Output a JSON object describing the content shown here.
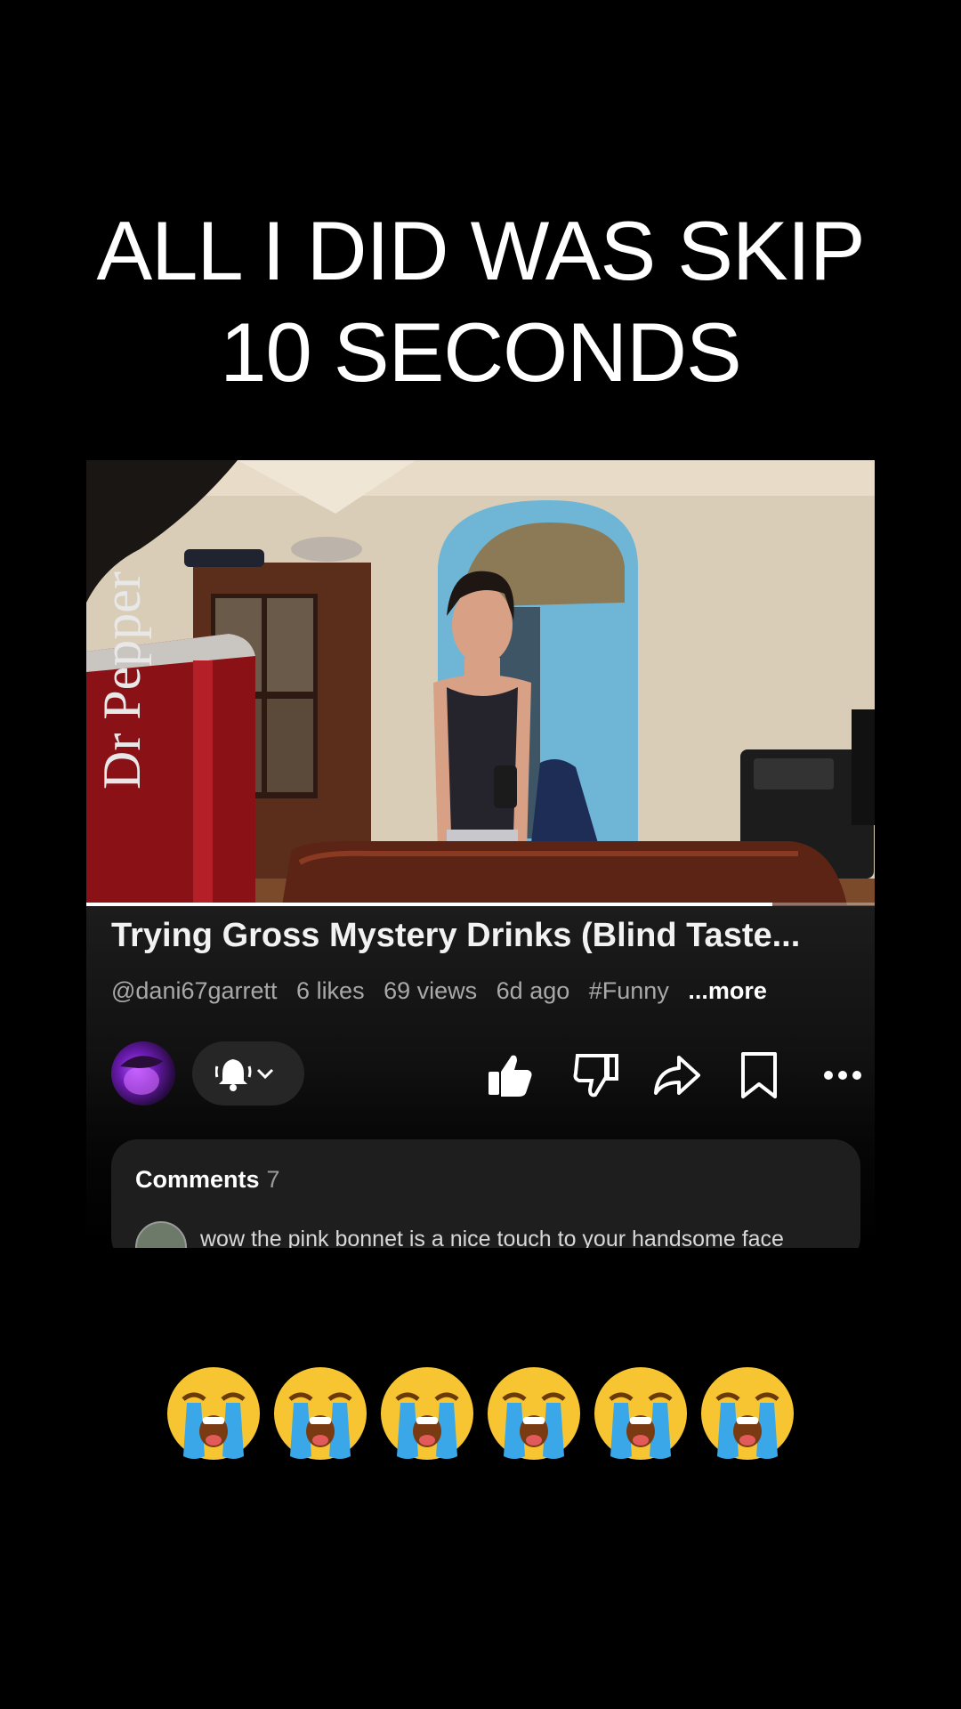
{
  "caption": {
    "line1": "ALL I DID WAS SKIP",
    "line2": "10 SECONDS"
  },
  "video": {
    "title": "Trying Gross Mystery Drinks (Blind Taste...",
    "channel": "@dani67garrett",
    "likes": "6 likes",
    "views": "69 views",
    "age": "6d ago",
    "hashtag": "#Funny",
    "more": "...more",
    "progress_fraction": 0.87,
    "can_text": "Dr Pepper"
  },
  "actions": [
    "like-icon",
    "dislike-icon",
    "share-icon",
    "save-icon",
    "more-icon"
  ],
  "comments": {
    "label": "Comments",
    "count": "7",
    "first_comment": "wow the pink bonnet is a nice touch to your handsome face"
  },
  "emojis": [
    "😭",
    "😭",
    "😭",
    "😭",
    "😭",
    "😭"
  ],
  "colors": {
    "background": "#000000",
    "panel": "#1c1c1c",
    "accent": "#ffffff"
  }
}
